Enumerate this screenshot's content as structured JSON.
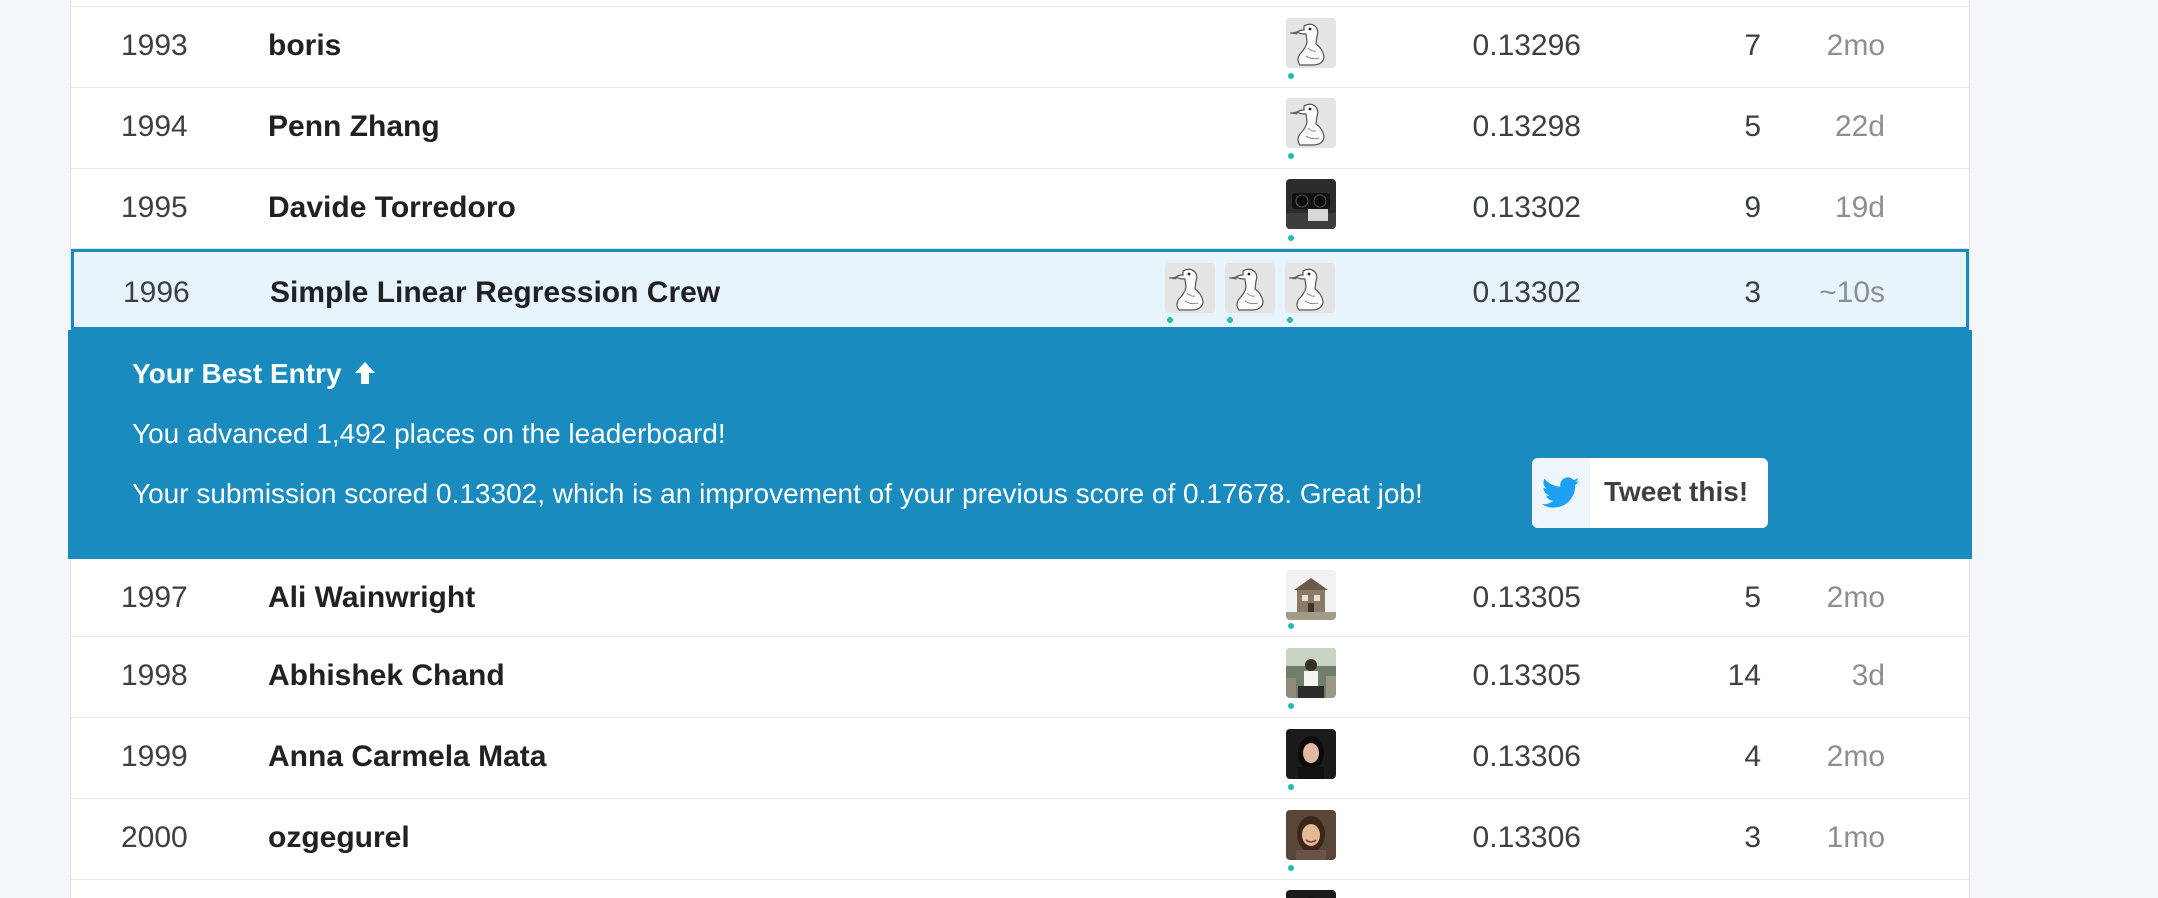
{
  "leaderboard": {
    "rows": [
      {
        "rank": "1993",
        "team": "boris",
        "score": "0.13296",
        "entries": "7",
        "last": "2mo",
        "avatars": [
          "goose"
        ]
      },
      {
        "rank": "1994",
        "team": "Penn Zhang",
        "score": "0.13298",
        "entries": "5",
        "last": "22d",
        "avatars": [
          "goose"
        ]
      },
      {
        "rank": "1995",
        "team": "Davide Torredoro",
        "score": "0.13302",
        "entries": "9",
        "last": "19d",
        "avatars": [
          "photo-dark"
        ]
      },
      {
        "rank": "1996",
        "team": "Simple Linear Regression Crew",
        "score": "0.13302",
        "entries": "3",
        "last": "~10s",
        "avatars": [
          "goose",
          "goose",
          "goose"
        ]
      },
      {
        "rank": "1997",
        "team": "Ali Wainwright",
        "score": "0.13305",
        "entries": "5",
        "last": "2mo",
        "avatars": [
          "photo-house"
        ]
      },
      {
        "rank": "1998",
        "team": "Abhishek Chand",
        "score": "0.13305",
        "entries": "14",
        "last": "3d",
        "avatars": [
          "photo-person-outdoor"
        ]
      },
      {
        "rank": "1999",
        "team": "Anna Carmela Mata",
        "score": "0.13306",
        "entries": "4",
        "last": "2mo",
        "avatars": [
          "photo-woman-dark"
        ]
      },
      {
        "rank": "2000",
        "team": "ozgegurel",
        "score": "0.13306",
        "entries": "3",
        "last": "1mo",
        "avatars": [
          "photo-woman-smile"
        ]
      }
    ]
  },
  "best_entry": {
    "title": "Your Best Entry",
    "title_icon": "arrow-up-icon",
    "advance_text": "You advanced 1,492 places on the leaderboard!",
    "detail_text": "Your submission scored 0.13302, which is an improvement of your previous score of 0.17678. Great job!",
    "tweet_label": "Tweet this!",
    "tweet_icon": "twitter-bird-icon"
  },
  "colors": {
    "accent": "#1a8bbf",
    "highlight_bg": "#e8f4fb",
    "online_dot": "#20beac",
    "twitter_blue": "#1da1f2"
  }
}
